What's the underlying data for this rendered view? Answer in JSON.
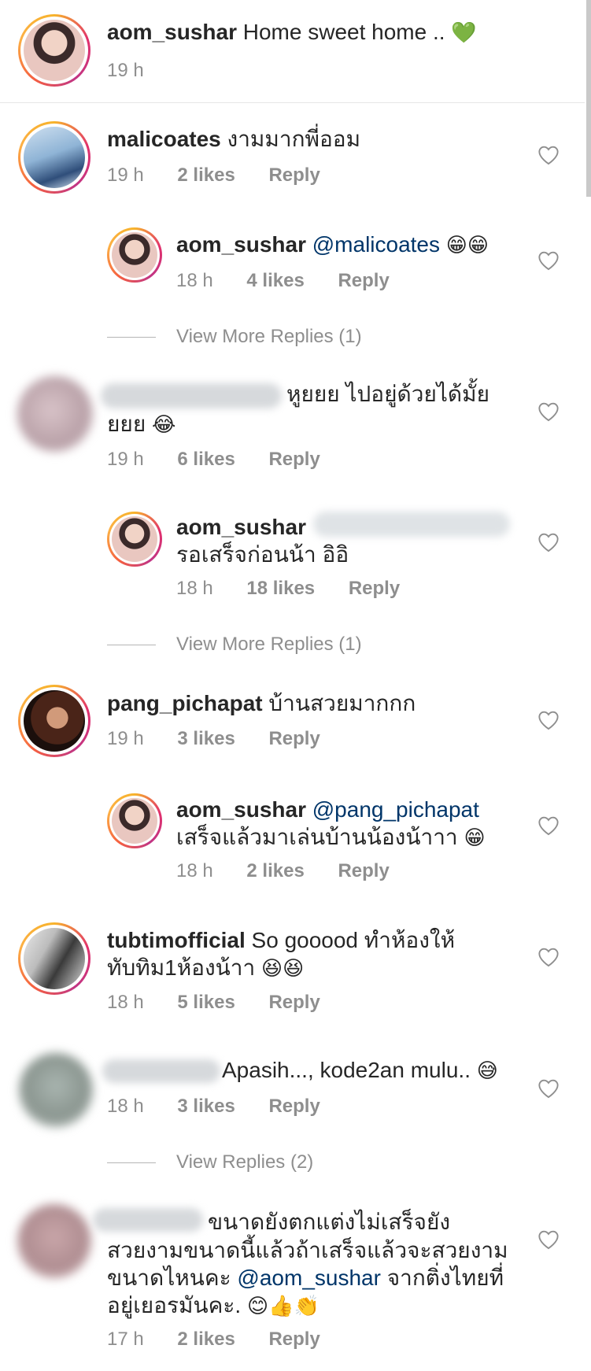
{
  "post": {
    "username": "aom_sushar",
    "caption": "Home sweet home ..",
    "caption_emoji": "💚",
    "time": "19 h"
  },
  "comments": [
    {
      "username": "malicoates",
      "text": "งามมากพี่ออม",
      "time": "19 h",
      "likes": "2 likes",
      "reply": "Reply"
    },
    {
      "username": "aom_sushar",
      "mention": "@malicoates",
      "emoji": "😁😁",
      "time": "18 h",
      "likes": "4 likes",
      "reply": "Reply"
    },
    {
      "view_more": "View More Replies (1)"
    },
    {
      "text_line1": "หูยยย ไปอยู่ด้วยได้มั้ย",
      "text_line2": "ยยย",
      "emoji": "😂",
      "time": "19 h",
      "likes": "6 likes",
      "reply": "Reply"
    },
    {
      "username": "aom_sushar",
      "text": "รอเสร็จก่อนน้า อิอิ",
      "time": "18 h",
      "likes": "18 likes",
      "reply": "Reply"
    },
    {
      "view_more": "View More Replies (1)"
    },
    {
      "username": "pang_pichapat",
      "text": "บ้านสวยมากกก",
      "time": "19 h",
      "likes": "3 likes",
      "reply": "Reply"
    },
    {
      "username": "aom_sushar",
      "mention": "@pang_pichapat",
      "text": "เสร็จแล้วมาเล่นบ้านน้องน้าาา",
      "emoji": "😁",
      "time": "18 h",
      "likes": "2 likes",
      "reply": "Reply"
    },
    {
      "username": "tubtimofficial",
      "text_line1": "So gooood ทำห้องให้",
      "text_line2": "ทับทิม1ห้องน้าา",
      "emoji": "😆😆",
      "time": "18 h",
      "likes": "5 likes",
      "reply": "Reply"
    },
    {
      "text": "Apasih..., kode2an mulu..",
      "emoji": "😅",
      "time": "18 h",
      "likes": "3 likes",
      "reply": "Reply"
    },
    {
      "view_more": "View Replies (2)"
    },
    {
      "text_line1": "ขนาดยังตกแต่งไม่เสร็จยัง",
      "text_line2": "สวยงามขนาดนี้แล้วถ้าเสร็จแล้วจะสวยงาม",
      "text_line3_pre": "ขนาดไหนคะ",
      "mention": "@aom_sushar",
      "text_line3_post": "จากติ่งไทยที่",
      "text_line4": "อยู่เยอรมันคะ.",
      "emoji": "😊👍👏",
      "time": "17 h",
      "likes": "2 likes",
      "reply": "Reply"
    }
  ],
  "icons": {
    "like": "heart-outline-icon"
  },
  "colors": {
    "mention": "#003569",
    "meta": "#8e8e8e",
    "ring": "#e1306c"
  }
}
